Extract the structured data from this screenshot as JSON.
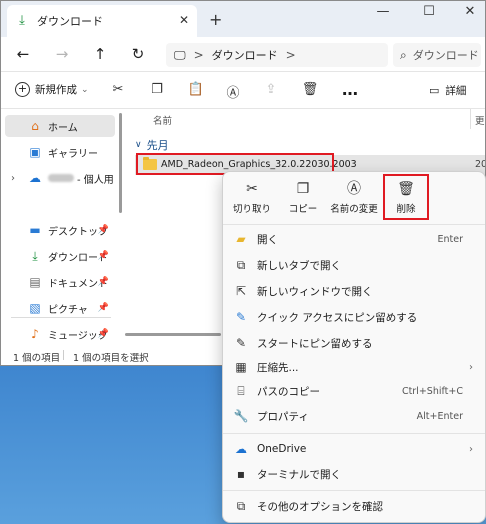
{
  "colors": {
    "accent": "#0067c0",
    "highlight_box": "#e01a22",
    "selected_row": "#e5e5e5"
  },
  "titlebar": {
    "tab_title": "ダウンロード",
    "tab_icon": "download-icon",
    "close_tab": "✕",
    "new_tab": "+",
    "minimize": "—",
    "maximize": "☐",
    "close": "✕"
  },
  "address": {
    "path_root_icon": "pc-icon",
    "separator": ">",
    "current": "ダウンロード",
    "trail": ">",
    "search_placeholder": "ダウンロード"
  },
  "toolbar": {
    "new_label": "新規作成",
    "more": "…",
    "details_label": "詳細"
  },
  "sidebar": {
    "items": [
      {
        "label": "ホーム",
        "icon": "home-icon"
      },
      {
        "label": "ギャラリー",
        "icon": "gallery-icon"
      },
      {
        "label": "- 個人用",
        "icon": "onedrive-icon"
      },
      {
        "label": "デスクトップ",
        "icon": "desktop-icon"
      },
      {
        "label": "ダウンロード",
        "icon": "download-icon"
      },
      {
        "label": "ドキュメント",
        "icon": "document-icon"
      },
      {
        "label": "ピクチャ",
        "icon": "pictures-icon"
      },
      {
        "label": "ミュージック",
        "icon": "music-icon"
      }
    ]
  },
  "content": {
    "col_name": "名前",
    "col_updated": "更",
    "group": "先月",
    "file": {
      "name": "AMD_Radeon_Graphics_32.0.22030.2003",
      "date": "20"
    }
  },
  "status": {
    "count": "1 個の項目",
    "selected": "1 個の項目を選択"
  },
  "context_menu": {
    "quick_actions": [
      {
        "label": "切り取り",
        "icon": "cut-icon"
      },
      {
        "label": "コピー",
        "icon": "copy-icon"
      },
      {
        "label": "名前の変更",
        "icon": "rename-icon"
      },
      {
        "label": "削除",
        "icon": "delete-icon"
      }
    ],
    "items": [
      {
        "label": "開く",
        "shortcut": "Enter",
        "icon": "folder-open-icon"
      },
      {
        "label": "新しいタブで開く",
        "icon": "new-tab-icon"
      },
      {
        "label": "新しいウィンドウで開く",
        "icon": "new-window-icon"
      },
      {
        "label": "クイック アクセスにピン留めする",
        "icon": "pin-icon"
      },
      {
        "label": "スタートにピン留めする",
        "icon": "pin-start-icon"
      },
      {
        "label": "圧縮先...",
        "icon": "zip-icon"
      },
      {
        "label": "パスのコピー",
        "shortcut": "Ctrl+Shift+C",
        "icon": "copy-path-icon"
      },
      {
        "label": "プロパティ",
        "shortcut": "Alt+Enter",
        "icon": "properties-icon"
      },
      {
        "label": "OneDrive",
        "icon": "onedrive-icon"
      },
      {
        "label": "ターミナルで開く",
        "icon": "terminal-icon"
      },
      {
        "label": "その他のオプションを確認",
        "icon": "more-options-icon"
      }
    ]
  }
}
